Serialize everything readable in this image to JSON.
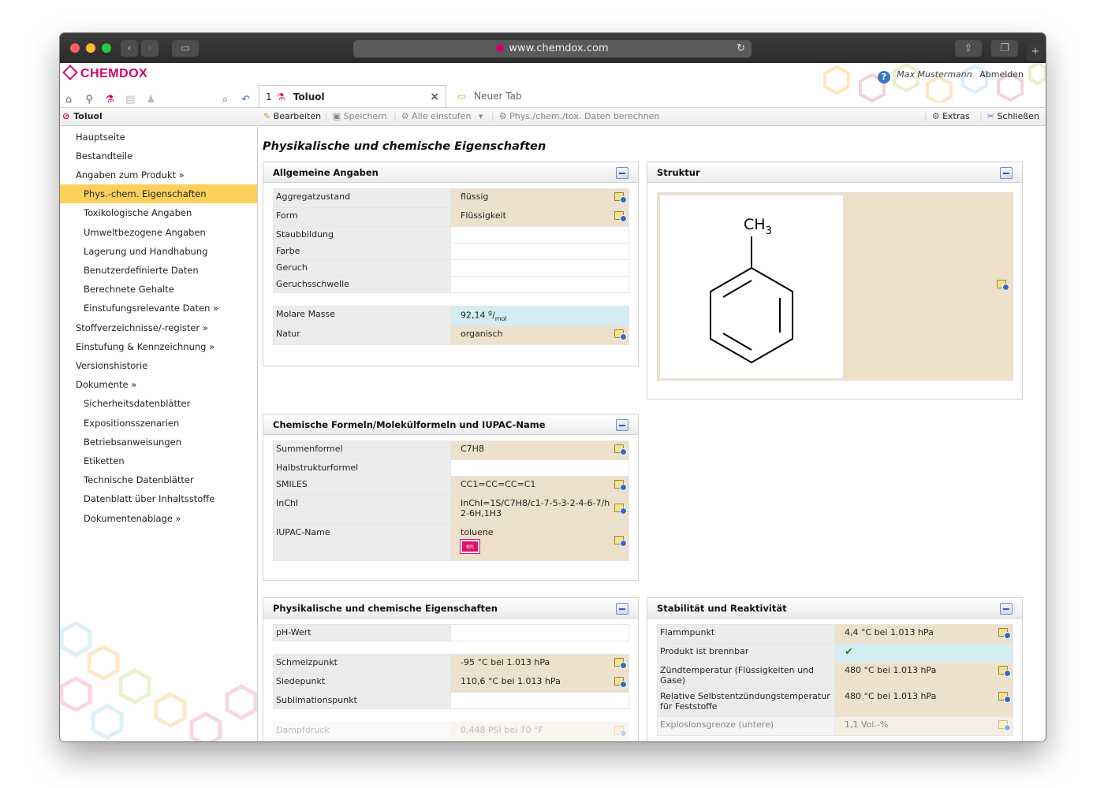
{
  "browser": {
    "url": "www.chemdox.com"
  },
  "header": {
    "logo_text": "CHEMDOX",
    "user_name": "Max Mustermann",
    "logout_label": "Abmelden"
  },
  "tabs": [
    {
      "index": "1",
      "label": "Toluol",
      "active": true
    },
    {
      "label": "Neuer Tab",
      "active": false
    }
  ],
  "sidebar_title": "Toluol",
  "toolbar": {
    "edit": "Bearbeiten",
    "save": "Speichern",
    "classify_all": "Alle einstufen",
    "calc": "Phys./chem./tox. Daten berechnen",
    "extras": "Extras",
    "close": "Schließen"
  },
  "nav": [
    {
      "label": "Hauptseite",
      "level": 1
    },
    {
      "label": "Bestandteile",
      "level": 1
    },
    {
      "label": "Angaben zum Produkt »",
      "level": 1
    },
    {
      "label": "Phys.-chem. Eigenschaften",
      "level": 2,
      "active": true
    },
    {
      "label": "Toxikologische Angaben",
      "level": 2
    },
    {
      "label": "Umweltbezogene Angaben",
      "level": 2
    },
    {
      "label": "Lagerung und Handhabung",
      "level": 2
    },
    {
      "label": "Benutzerdefinierte Daten",
      "level": 2
    },
    {
      "label": "Berechnete Gehalte",
      "level": 2
    },
    {
      "label": "Einstufungsrelevante Daten »",
      "level": 2
    },
    {
      "label": "Stoffverzeichnisse/-register »",
      "level": 1
    },
    {
      "label": "Einstufung & Kennzeichnung »",
      "level": 1
    },
    {
      "label": "Versionshistorie",
      "level": 1
    },
    {
      "label": "Dokumente »",
      "level": 1
    },
    {
      "label": "Sicherheitsdatenblätter",
      "level": 2
    },
    {
      "label": "Expositionsszenarien",
      "level": 2
    },
    {
      "label": "Betriebsanweisungen",
      "level": 2
    },
    {
      "label": "Etiketten",
      "level": 2
    },
    {
      "label": "Technische Datenblätter",
      "level": 2
    },
    {
      "label": "Datenblatt über Inhaltsstoffe",
      "level": 2
    },
    {
      "label": "Dokumentenablage »",
      "level": 2
    }
  ],
  "page_title": "Physikalische und chemische Eigenschaften",
  "panels": {
    "general": {
      "title": "Allgemeine Angaben",
      "rows": [
        {
          "label": "Aggregatzustand",
          "value": "flüssig"
        },
        {
          "label": "Form",
          "value": "Flüssigkeit"
        },
        {
          "label": "Staubbildung",
          "value": ""
        },
        {
          "label": "Farbe",
          "value": ""
        },
        {
          "label": "Geruch",
          "value": ""
        },
        {
          "label": "Geruchsschwelle",
          "value": ""
        }
      ],
      "rows2": [
        {
          "label": "Molare Masse",
          "value": "92,14",
          "unit_num": "g",
          "unit_den": "mol"
        },
        {
          "label": "Natur",
          "value": "organisch"
        }
      ]
    },
    "structure": {
      "title": "Struktur",
      "substituent": "CH",
      "substituent_sub": "3"
    },
    "formulas": {
      "title": "Chemische Formeln/Molekülformeln und IUPAC-Name",
      "rows": [
        {
          "label": "Summenformel",
          "value": "C7H8"
        },
        {
          "label": "Halbstrukturformel",
          "value": ""
        },
        {
          "label": "SMILES",
          "value": "CC1=CC=CC=C1"
        },
        {
          "label": "InChI",
          "value": "InChI=1S/C7H8/c1-7-5-3-2-4-6-7/h2-6H,1H3"
        },
        {
          "label": "IUPAC-Name",
          "value": "toluene",
          "lang": "en"
        }
      ]
    },
    "physchem": {
      "title": "Physikalische und chemische Eigenschaften",
      "rows": [
        {
          "label": "pH-Wert",
          "value": ""
        }
      ],
      "rows2": [
        {
          "label": "Schmelzpunkt",
          "value": "-95 °C bei 1.013 hPa"
        },
        {
          "label": "Siedepunkt",
          "value": "110,6 °C bei 1.013 hPa"
        },
        {
          "label": "Sublimationspunkt",
          "value": ""
        }
      ],
      "rows3": [
        {
          "label": "Dampfdruck",
          "value": "0,448 PSI bei 70 °F"
        }
      ]
    },
    "stability": {
      "title": "Stabilität und Reaktivität",
      "rows": [
        {
          "label": "Flammpunkt",
          "value": "4,4 °C bei 1.013 hPa"
        },
        {
          "label": "Produkt ist brennbar",
          "value": ""
        },
        {
          "label": "Zündtemperatur (Flüssigkeiten und Gase)",
          "value": "480 °C bei 1.013 hPa"
        },
        {
          "label": "Relative Selbstentzündungstemperatur für Feststoffe",
          "value": "480 °C bei 1.013 hPa"
        },
        {
          "label": "Explosionsgrenze (untere)",
          "value": "1,1 Vol.-%"
        }
      ]
    }
  },
  "colors": {
    "brand": "#d6006a",
    "nav_active": "#fbd15c",
    "value_tan": "#ede1cc",
    "value_blue": "#d3edf2"
  }
}
